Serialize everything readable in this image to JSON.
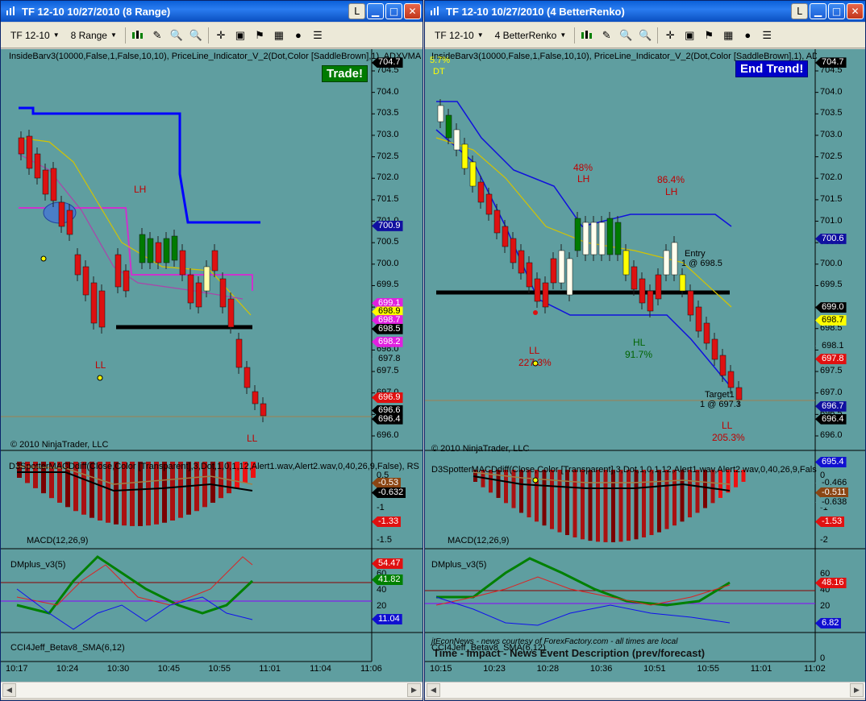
{
  "left": {
    "title": "TF 12-10  10/27/2010 (8 Range)",
    "toolbar": {
      "instrument": "TF 12-10",
      "period": "8 Range"
    },
    "title_buttons": {
      "l": "L",
      "min": "▁",
      "max": "□",
      "close": "✕"
    },
    "indicator_line": "InsideBarv3(10000,False,1,False,10,10), PriceLine_Indicator_V_2(Dot,Color [SaddleBrown],1), ADXVMA",
    "copyright": "© 2010 NinjaTrader, LLC",
    "d3_label": "D3SpotterMACDdiff(Close,Color [Transparent],3,Dot,1,0,1,12,Alert1.wav,Alert2.wav,0,40,26,9,False), RS",
    "macd_label": "MACD(12,26,9)",
    "dmplus_label": "DMplus_v3(5)",
    "cci_label": "CCI4Jeff_Betav8_SMA(6,12)",
    "badge": "Trade!",
    "annotations": {
      "lh": "LH",
      "ll1": "LL",
      "ll2": "LL"
    },
    "price_axis": [
      "704.5",
      "704.0",
      "703.5",
      "703.0",
      "702.5",
      "702.0",
      "701.5",
      "701.0",
      "700.5",
      "700.0",
      "699.5",
      "699.0",
      "698.5",
      "698.0",
      "697.5",
      "697.0",
      "696.5",
      "696.0"
    ],
    "price_tags": [
      {
        "text": "704.7",
        "bg": "#000000",
        "fg": "#ffffff"
      },
      {
        "text": "700.9",
        "bg": "#1010a0",
        "fg": "#ffffff"
      },
      {
        "text": "699.1",
        "bg": "#e020e0",
        "fg": "#ffffff"
      },
      {
        "text": "698.9",
        "bg": "#ffff00",
        "fg": "#000000"
      },
      {
        "text": "698.7",
        "bg": "#e020e0",
        "fg": "#ffffff"
      },
      {
        "text": "698.5",
        "bg": "#000000",
        "fg": "#ffffff"
      },
      {
        "text": "698.2",
        "bg": "#e020e0",
        "fg": "#ffffff"
      },
      {
        "text": "697.8",
        "bg": "#5f9ea0",
        "fg": "#000000"
      },
      {
        "text": "696.9",
        "bg": "#e01010",
        "fg": "#ffffff"
      },
      {
        "text": "696.6",
        "bg": "#000000",
        "fg": "#ffffff"
      },
      {
        "text": "696.4",
        "bg": "#000000",
        "fg": "#ffffff"
      }
    ],
    "macd_axis": [
      "0.5",
      "-1",
      "-1.5"
    ],
    "macd_tags": [
      {
        "text": "-0.53",
        "bg": "#8b4513",
        "fg": "#ffffff"
      },
      {
        "text": "-0.632",
        "bg": "#000000",
        "fg": "#ffffff"
      },
      {
        "text": "-1.33",
        "bg": "#e01010",
        "fg": "#ffffff"
      }
    ],
    "dm_axis": [
      "60",
      "40",
      "20"
    ],
    "dm_tags": [
      {
        "text": "54.47",
        "bg": "#e01010",
        "fg": "#ffffff"
      },
      {
        "text": "41.82",
        "bg": "#008000",
        "fg": "#ffffff"
      },
      {
        "text": "11.04",
        "bg": "#1010d0",
        "fg": "#ffffff"
      }
    ],
    "time_axis": [
      "10:17",
      "10:24",
      "10:30",
      "10:45",
      "10:55",
      "11:01",
      "11:04",
      "11:06"
    ]
  },
  "right": {
    "title": "TF 12-10  10/27/2010 (4 BetterRenko)",
    "toolbar": {
      "instrument": "TF 12-10",
      "period": "4 BetterRenko"
    },
    "title_buttons": {
      "l": "L",
      "min": "▁",
      "max": "□",
      "close": "✕"
    },
    "indicator_line": "InsideBarv3(10000,False,1,False,10,10), PriceLine_Indicator_V_2(Dot,Color [SaddleBrown],1), ADXVMA_v01",
    "copyright": "© 2010 NinjaTrader, LLC",
    "d3_label": "D3SpotterMACDdiff(Close,Color [Transparent],3,Dot,1,0,1,12,Alert1.wav,Alert2.wav,0,40,26,9,False), RSqueeze",
    "macd_label": "MACD(12,26,9)",
    "dmplus_label": "DMplus_v3(5)",
    "cci_label": "CCI4Jeff_Betav8_SMA(6,12)",
    "news_header_small": "jtEconNews - news courtesy of ForexFactory.com - all times are local",
    "news_header": "Time  -  Impact  -  News Event Description (prev/forecast)",
    "badge": "End Trend!",
    "top_left": {
      "pct": "5.7%",
      "dt": "DT"
    },
    "annotations": {
      "p48": "48%",
      "lh1": "LH",
      "p864": "86.4%",
      "lh2": "LH",
      "entry": "Entry",
      "entry_price": "1 @ 698.5",
      "hl": "HL",
      "p917": "91.7%",
      "ll1": "LL",
      "p227": "227.3%",
      "target": "Target1",
      "target_price": "1 @ 697.3",
      "ll2": "LL",
      "p2053": "205.3%"
    },
    "price_axis": [
      "704.5",
      "704.0",
      "703.5",
      "703.0",
      "702.5",
      "702.0",
      "701.5",
      "701.0",
      "700.5",
      "700.0",
      "699.5",
      "699.0",
      "698.5",
      "698.0",
      "697.5",
      "697.0",
      "696.5",
      "696.0"
    ],
    "price_tags": [
      {
        "text": "704.7",
        "bg": "#000000",
        "fg": "#ffffff"
      },
      {
        "text": "700.6",
        "bg": "#1010a0",
        "fg": "#ffffff"
      },
      {
        "text": "699.0",
        "bg": "#000000",
        "fg": "#ffffff"
      },
      {
        "text": "698.7",
        "bg": "#ffff00",
        "fg": "#000000"
      },
      {
        "text": "698.1",
        "bg": "#5f9ea0",
        "fg": "#000000"
      },
      {
        "text": "697.8",
        "bg": "#e01010",
        "fg": "#ffffff"
      },
      {
        "text": "696.7",
        "bg": "#1010a0",
        "fg": "#ffffff"
      },
      {
        "text": "696.4",
        "bg": "#000000",
        "fg": "#ffffff"
      },
      {
        "text": "695.4",
        "bg": "#1010d0",
        "fg": "#ffffff"
      }
    ],
    "macd_axis": [
      "0",
      "-1",
      "-2"
    ],
    "macd_tags": [
      {
        "text": "-0.466",
        "bg": "#5f9ea0",
        "fg": "#000000"
      },
      {
        "text": "-0.511",
        "bg": "#8b4513",
        "fg": "#ffffff"
      },
      {
        "text": "-0.638",
        "bg": "#5f9ea0",
        "fg": "#000000"
      },
      {
        "text": "-1.53",
        "bg": "#e01010",
        "fg": "#ffffff"
      }
    ],
    "dm_axis": [
      "60",
      "40",
      "20"
    ],
    "dm_tags": [
      {
        "text": "48.16",
        "bg": "#e01010",
        "fg": "#ffffff"
      },
      {
        "text": "6.82",
        "bg": "#1010d0",
        "fg": "#ffffff"
      }
    ],
    "cci_axis": [
      "0"
    ],
    "time_axis": [
      "10:15",
      "10:23",
      "10:28",
      "10:36",
      "10:51",
      "10:55",
      "11:01",
      "11:02"
    ]
  }
}
